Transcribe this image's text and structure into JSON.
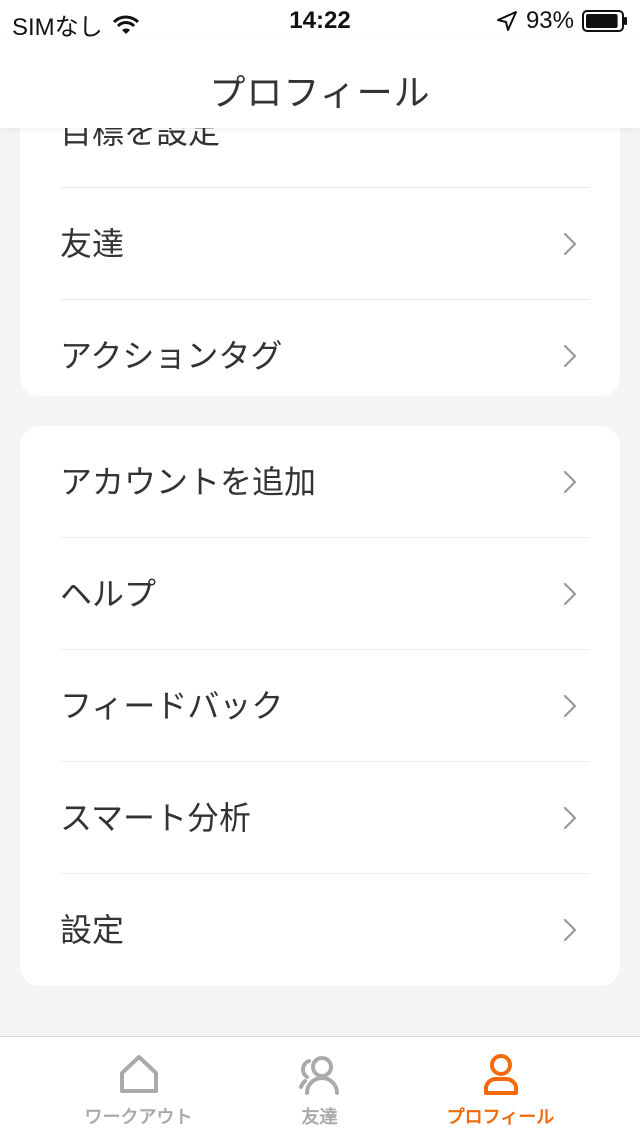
{
  "status_bar": {
    "carrier": "SIMなし",
    "time": "14:22",
    "battery": "93%",
    "battery_level": 0.93
  },
  "nav": {
    "title": "プロフィール"
  },
  "card_1": {
    "items": [
      {
        "label": "目標を設定"
      },
      {
        "label": "友達"
      },
      {
        "label": "アクションタグ"
      }
    ]
  },
  "card_2": {
    "items": [
      {
        "label": "アカウントを追加"
      },
      {
        "label": "ヘルプ"
      },
      {
        "label": "フィードバック"
      },
      {
        "label": "スマート分析"
      },
      {
        "label": "設定"
      }
    ]
  },
  "tab_bar": {
    "tabs": [
      {
        "label": "ワークアウト",
        "icon": "home-icon",
        "active": false
      },
      {
        "label": "友達",
        "icon": "friends-icon",
        "active": false
      },
      {
        "label": "プロフィール",
        "icon": "profile-icon",
        "active": true
      }
    ]
  },
  "colors": {
    "accent": "#f36a0a",
    "inactive": "#aaaaaa",
    "background": "#f5f5f5"
  }
}
